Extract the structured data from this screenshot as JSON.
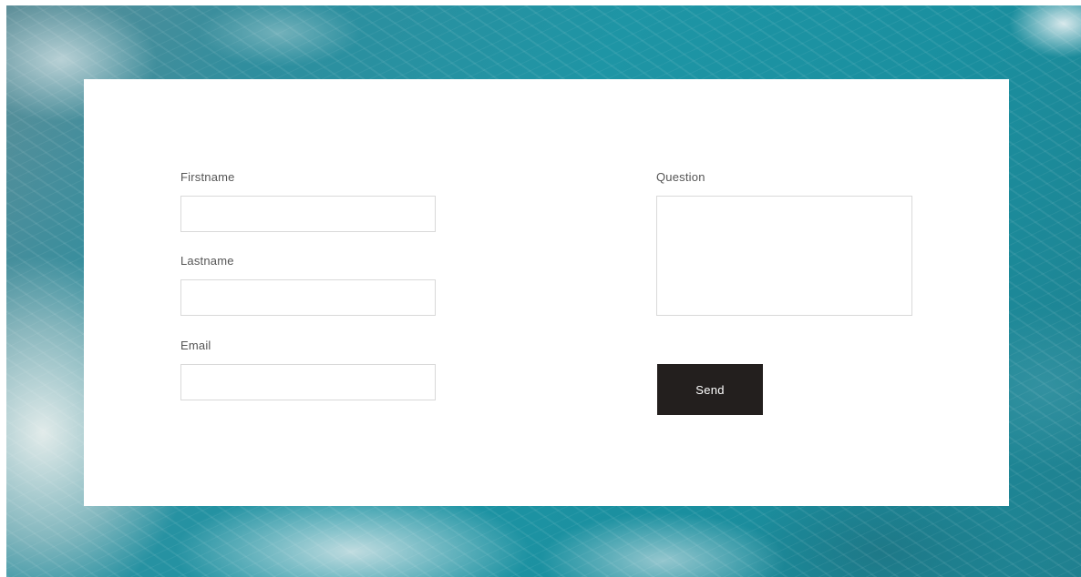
{
  "form": {
    "firstname": {
      "label": "Firstname",
      "value": "",
      "placeholder": ""
    },
    "lastname": {
      "label": "Lastname",
      "value": "",
      "placeholder": ""
    },
    "email": {
      "label": "Email",
      "value": "",
      "placeholder": ""
    },
    "question": {
      "label": "Question",
      "value": "",
      "placeholder": ""
    },
    "send_label": "Send"
  },
  "colors": {
    "button_background": "#231f1e",
    "button_text": "#ffffff",
    "field_border": "#d9d9d9",
    "label_text": "#555555",
    "card_background": "#ffffff"
  }
}
